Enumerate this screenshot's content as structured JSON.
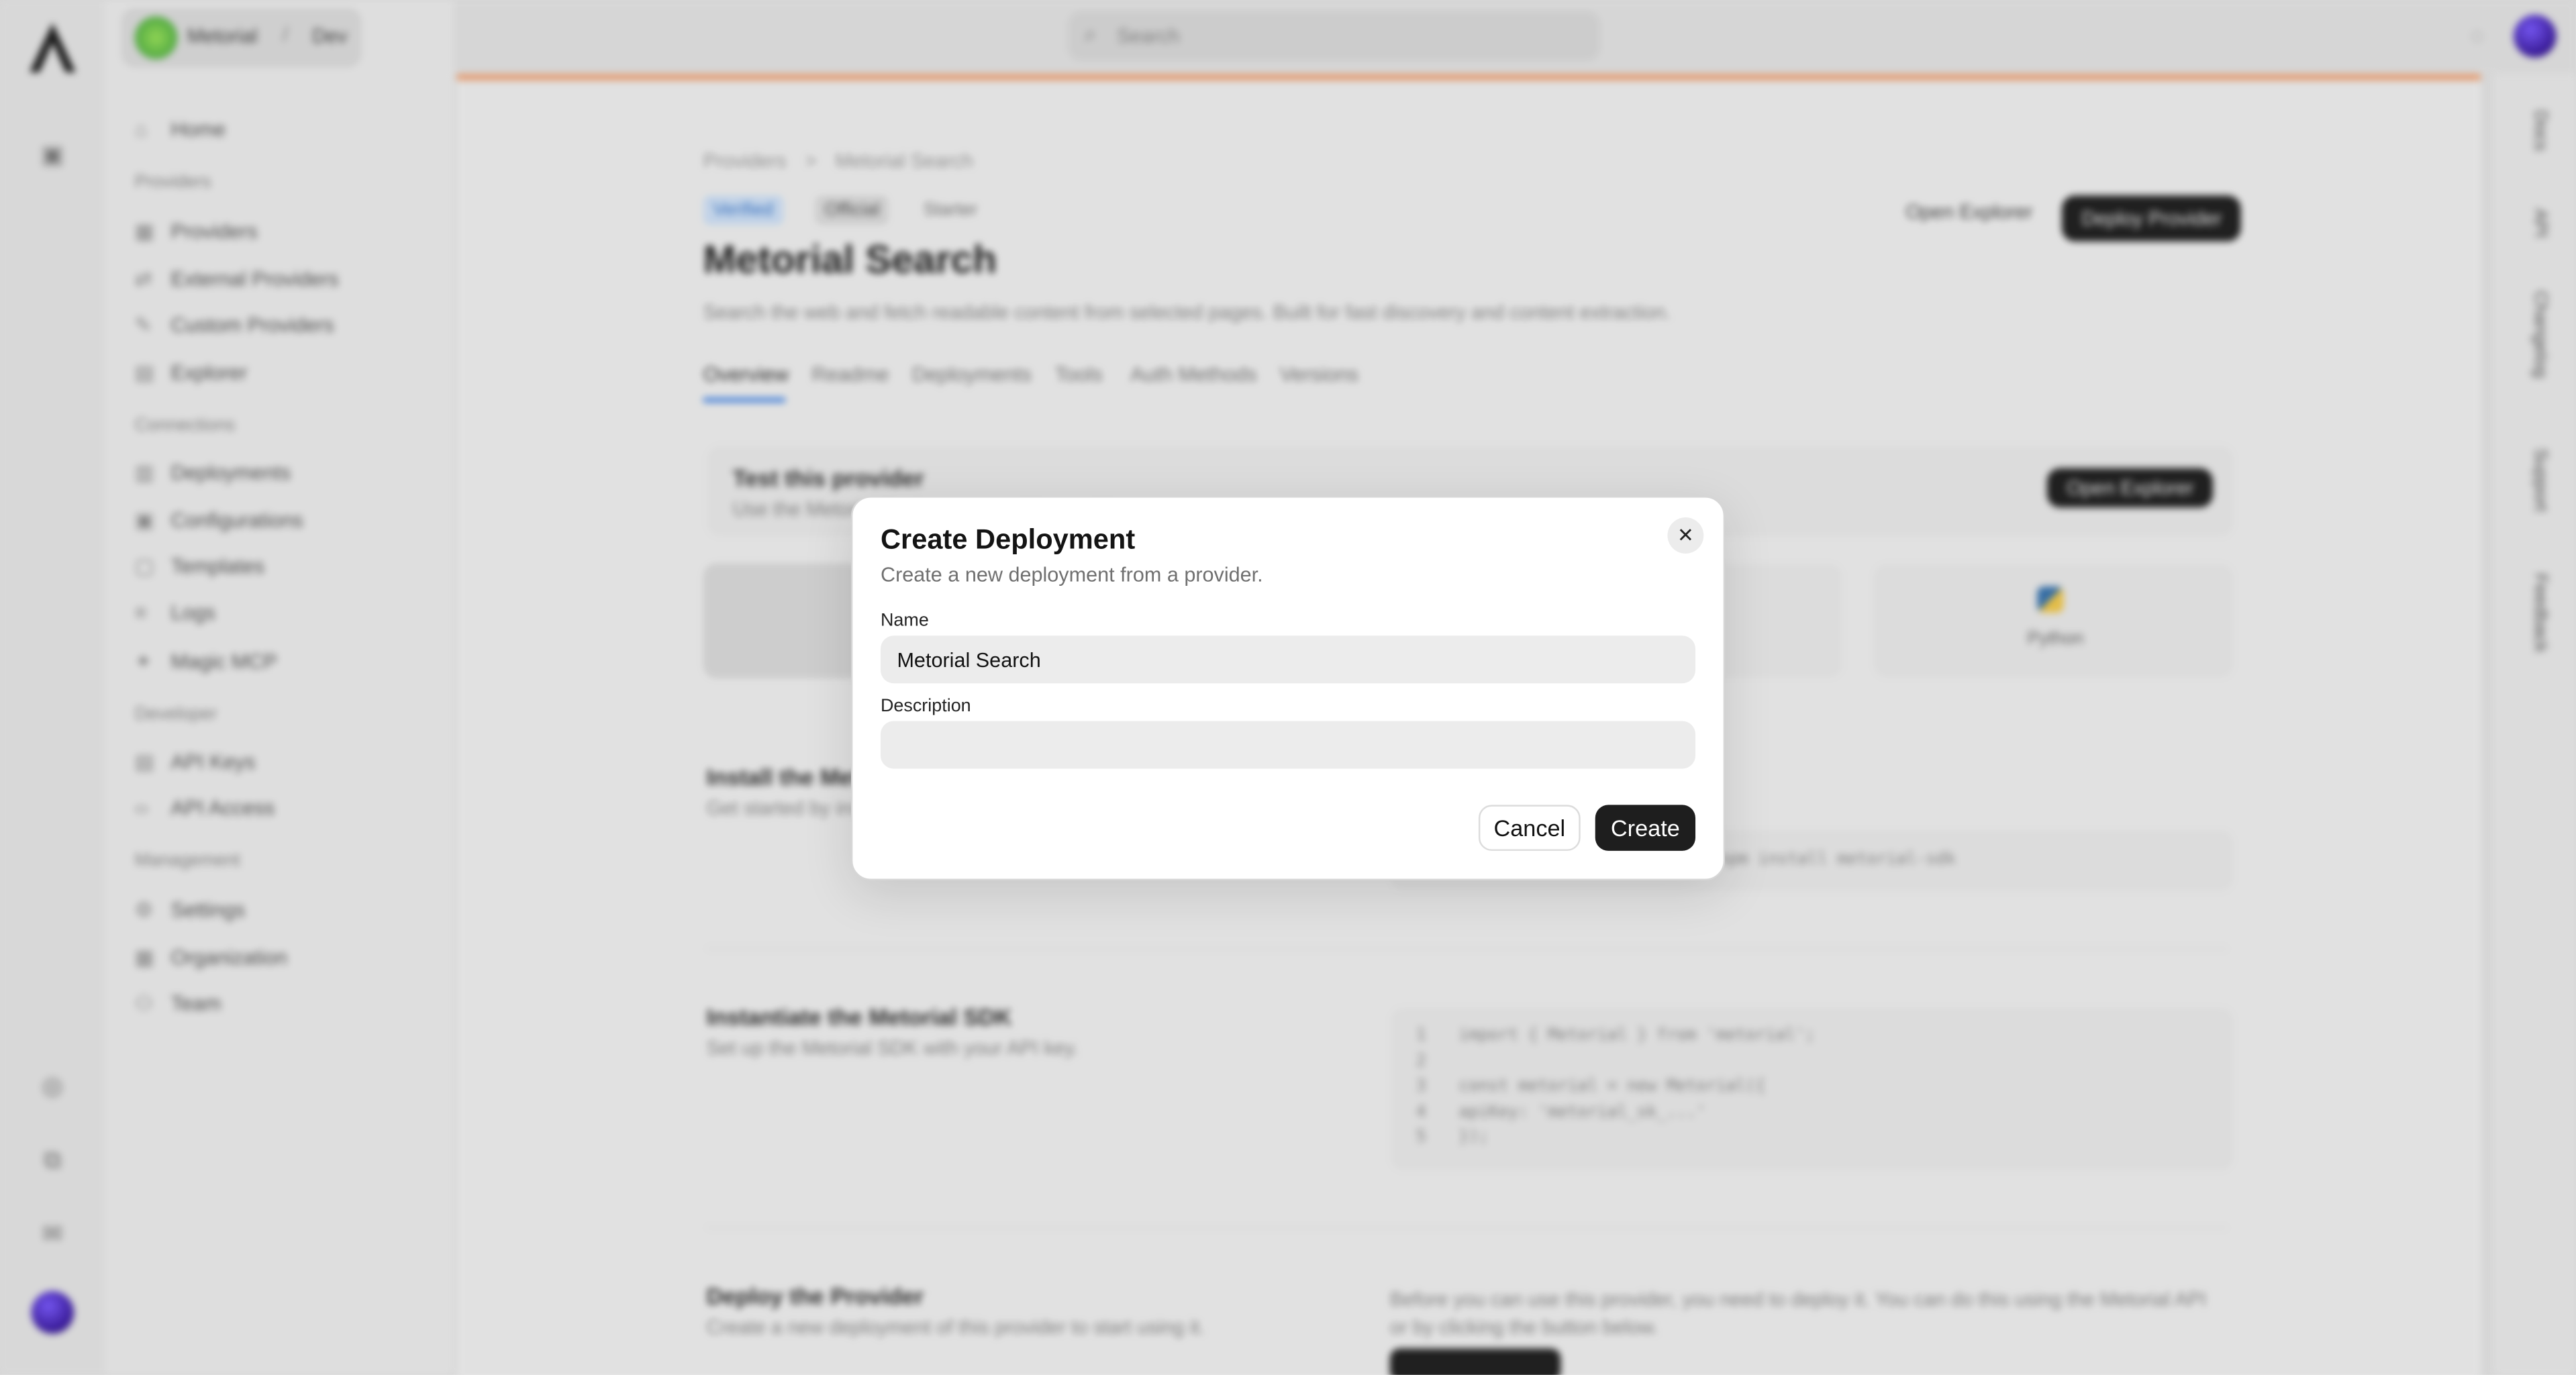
{
  "workspace": {
    "org": "Metorial",
    "separator": "/",
    "env": "Dev"
  },
  "search": {
    "placeholder": "Search"
  },
  "sidebar": {
    "items": [
      {
        "label": "Home",
        "icon": "home-icon"
      },
      {
        "group": "Providers"
      },
      {
        "label": "Providers",
        "icon": "grid-icon"
      },
      {
        "label": "External Providers",
        "icon": "link-icon"
      },
      {
        "label": "Custom Providers",
        "icon": "brush-icon"
      },
      {
        "label": "Explorer",
        "icon": "file-icon"
      },
      {
        "group": "Connections"
      },
      {
        "label": "Deployments",
        "icon": "layers-icon"
      },
      {
        "label": "Configurations",
        "icon": "settings-icon"
      },
      {
        "label": "Templates",
        "icon": "template-icon"
      },
      {
        "label": "Logs",
        "icon": "list-icon"
      },
      {
        "label": "Magic MCP",
        "icon": "magic-icon"
      },
      {
        "group": "Developer"
      },
      {
        "label": "API Keys",
        "icon": "key-icon"
      },
      {
        "label": "API Access",
        "icon": "code-icon"
      },
      {
        "group": "Management"
      },
      {
        "label": "Settings",
        "icon": "gear-icon"
      },
      {
        "label": "Organization",
        "icon": "building-icon"
      },
      {
        "label": "Team",
        "icon": "users-icon"
      }
    ]
  },
  "right_tabs": [
    "Docs",
    "API",
    "Changelog",
    "Support",
    "Feedback"
  ],
  "page": {
    "breadcrumb": [
      "Providers",
      ">",
      "Metorial Search"
    ],
    "badges": [
      "Verified",
      "Official",
      "Starter"
    ],
    "title": "Metorial Search",
    "description": "Search the web and fetch readable content from selected pages. Built for fast discovery and content extraction.",
    "open_explorer": "Open Explorer",
    "deploy_provider": "Deploy Provider",
    "tabs": [
      "Overview",
      "Readme",
      "Deployments",
      "Tools",
      "Auth Methods",
      "Versions"
    ],
    "test_card": {
      "title": "Test this provider",
      "subtitle": "Use the Metorial Explorer to test this provider",
      "button": "Open Explorer"
    },
    "sdk_tile": "Python",
    "install_title": "Install the Metorial SDK",
    "install_sub": "Get started by installing the Metorial SDK",
    "install_cmd": "npm install metorial-sdk",
    "instantiate_title": "Instantiate the Metorial SDK",
    "instantiate_sub": "Set up the Metorial SDK with your API key.",
    "code_lines": [
      "import { Metorial } from 'metorial';",
      "",
      "const metorial = new Metorial({",
      "  apiKey: 'metorial_sk_...'",
      "});"
    ],
    "deploy_title": "Deploy the Provider",
    "deploy_sub": "Create a new deployment of this provider to start using it.",
    "deploy_text": "Before you can use this provider, you need to deploy it. You can do this using the Metorial API or by clicking the button below."
  },
  "modal": {
    "title": "Create Deployment",
    "subtitle": "Create a new deployment from a provider.",
    "name_label": "Name",
    "name_value": "Metorial Search",
    "description_label": "Description",
    "description_value": "",
    "cancel": "Cancel",
    "create": "Create",
    "close_glyph": "✕"
  }
}
